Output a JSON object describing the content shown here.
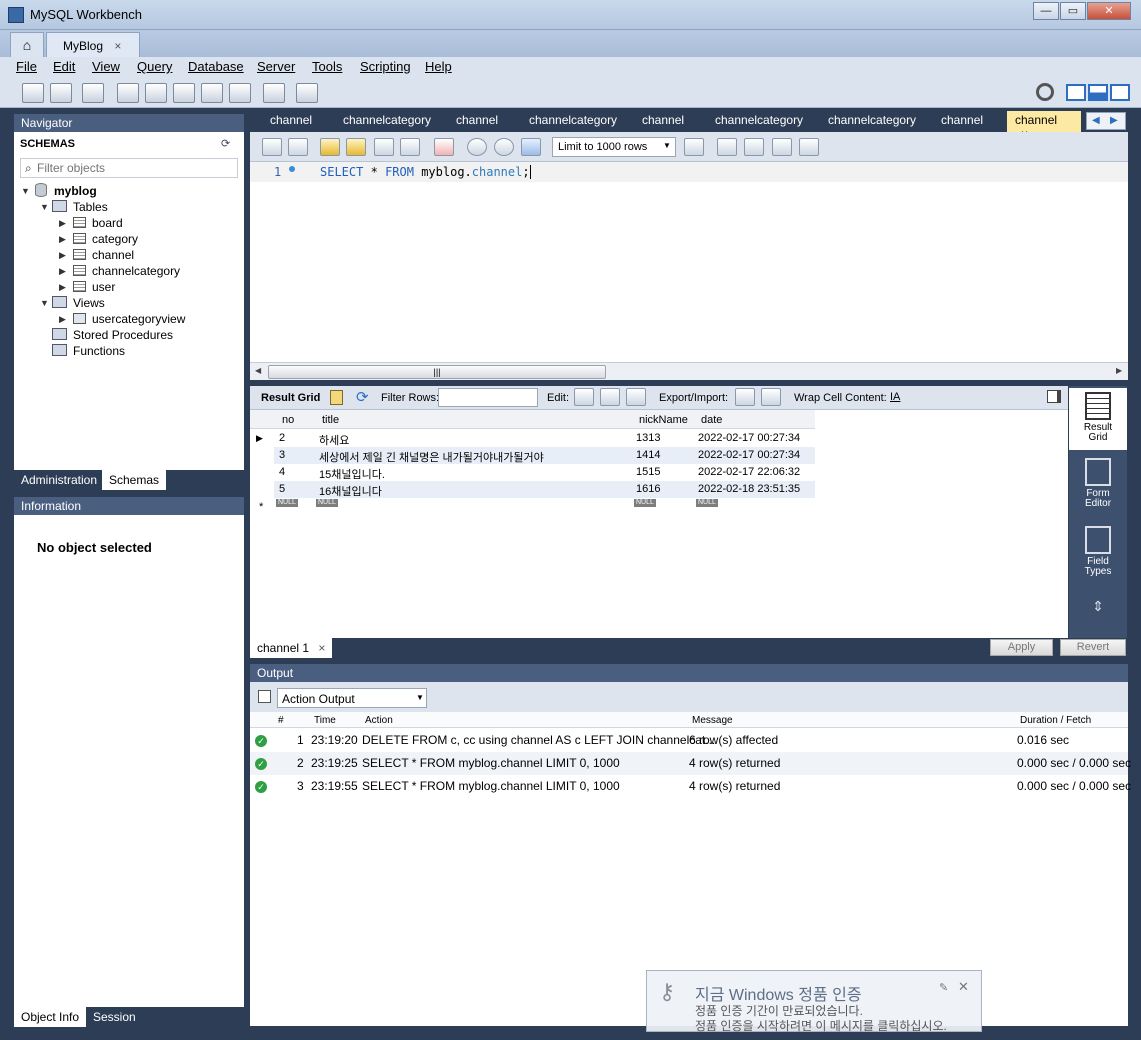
{
  "window": {
    "title": "MySQL Workbench",
    "controls": [
      "—",
      "▭",
      "✕"
    ]
  },
  "tabs": {
    "home_icon": "home-icon",
    "connection_tab": "MyBlog",
    "close": "×"
  },
  "menu": [
    "File",
    "Edit",
    "View",
    "Query",
    "Database",
    "Server",
    "Tools",
    "Scripting",
    "Help"
  ],
  "navigator": {
    "header": "Navigator",
    "schemas_label": "SCHEMAS",
    "filter_placeholder": "Filter objects",
    "schema": "myblog",
    "tables_label": "Tables",
    "tables": [
      "board",
      "category",
      "channel",
      "channelcategory",
      "user"
    ],
    "views_label": "Views",
    "views": [
      "usercategoryview"
    ],
    "stored_procedures": "Stored Procedures",
    "functions": "Functions",
    "tabs": [
      "Administration",
      "Schemas"
    ]
  },
  "information": {
    "header": "Information",
    "empty": "No object selected",
    "tabs": [
      "Object Info",
      "Session"
    ]
  },
  "query_tabs": [
    "channel",
    "channelcategory",
    "channel",
    "channelcategory",
    "channel",
    "channelcategory",
    "channelcategory",
    "channel",
    "channel"
  ],
  "editor": {
    "limit": "Limit to 1000 rows",
    "line_number": "1",
    "sql_keyword1": "SELECT",
    "sql_star": "*",
    "sql_keyword2": "FROM",
    "sql_schema": "myblog.",
    "sql_table": "channel",
    "sql_end": ";"
  },
  "result_toolbar": {
    "result_grid": "Result Grid",
    "filter_rows": "Filter Rows:",
    "edit": "Edit:",
    "export_import": "Export/Import:",
    "wrap": "Wrap Cell Content:"
  },
  "result_grid": {
    "columns": [
      "no",
      "title",
      "nickName",
      "date"
    ],
    "rows": [
      [
        "2",
        "하세요",
        "1313",
        "2022-02-17 00:27:34"
      ],
      [
        "3",
        "세상에서 제일 긴 채널명은 내가될거야내가될거야",
        "1414",
        "2022-02-17 00:27:34"
      ],
      [
        "4",
        "15채널입니다.",
        "1515",
        "2022-02-17 22:06:32"
      ],
      [
        "5",
        "16채널입니다",
        "1616",
        "2022-02-18 23:51:35"
      ]
    ],
    "null_label": "NULL",
    "new_row_marker": "*"
  },
  "side_buttons": [
    {
      "line1": "Result",
      "line2": "Grid",
      "icon": "result-grid-icon"
    },
    {
      "line1": "Form",
      "line2": "Editor",
      "icon": "form-editor-icon"
    },
    {
      "line1": "Field",
      "line2": "Types",
      "icon": "field-types-icon"
    }
  ],
  "result_tab": "channel 1",
  "buttons": {
    "apply": "Apply",
    "revert": "Revert"
  },
  "output": {
    "header": "Output",
    "selector": "Action Output",
    "columns": [
      "#",
      "Time",
      "Action",
      "Message",
      "Duration / Fetch"
    ],
    "rows": [
      {
        "n": "1",
        "time": "23:19:20",
        "action": "DELETE FROM c, cc using channel AS c LEFT JOIN channelcat...",
        "message": "6 row(s) affected",
        "duration": "0.016 sec"
      },
      {
        "n": "2",
        "time": "23:19:25",
        "action": "SELECT * FROM myblog.channel LIMIT 0, 1000",
        "message": "4 row(s) returned",
        "duration": "0.000 sec / 0.000 sec"
      },
      {
        "n": "3",
        "time": "23:19:55",
        "action": "SELECT * FROM myblog.channel LIMIT 0, 1000",
        "message": "4 row(s) returned",
        "duration": "0.000 sec / 0.000 sec"
      }
    ]
  },
  "activation": {
    "title": "지금 Windows 정품 인증",
    "line1": "정품 인증 기간이 만료되었습니다.",
    "line2": "정품 인증을 시작하려면 이 메시지를 클릭하십시오."
  },
  "colors": {
    "navy": "#2d3d55",
    "panel_header": "#4a5f80",
    "active_tab": "#fce9a4",
    "keyword": "#1f5fbf"
  }
}
